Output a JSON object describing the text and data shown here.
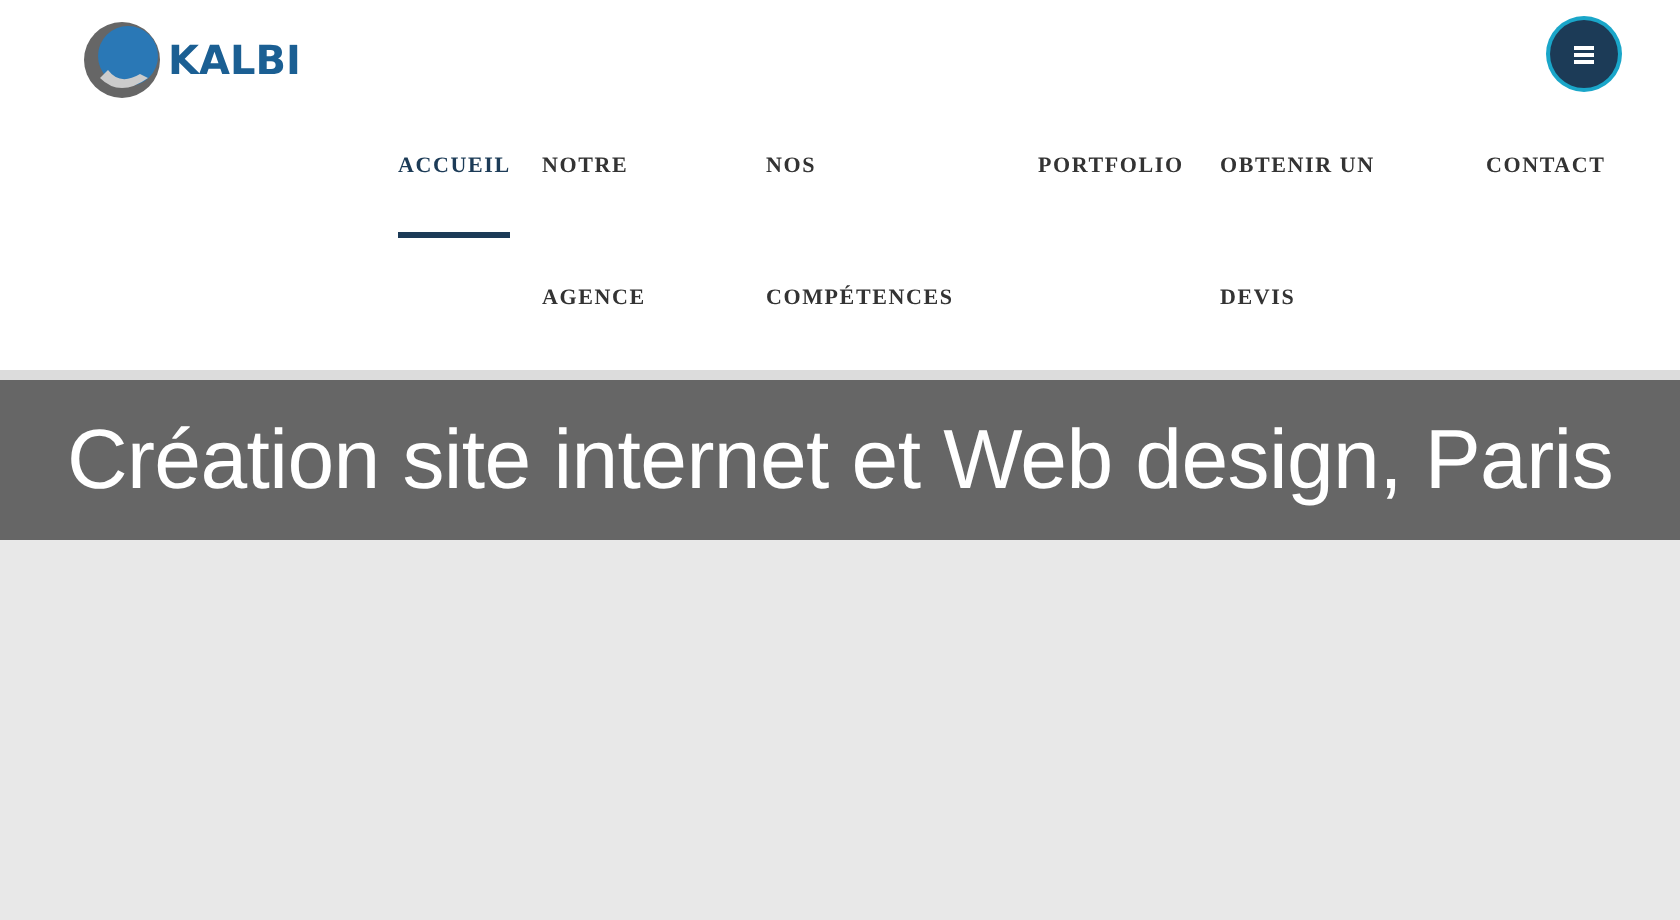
{
  "header": {
    "logo": {
      "text": "KALBI"
    }
  },
  "nav": [
    {
      "label": "ACCUEIL",
      "selected": true
    },
    {
      "label": "NOTRE AGENCE",
      "selected": false
    },
    {
      "label": "NOS COMPÉTENCES",
      "selected": false
    },
    {
      "label": "PORTFOLIO",
      "selected": false
    },
    {
      "label": "OBTENIR UN DEVIS",
      "selected": false
    },
    {
      "label": "CONTACT",
      "selected": false
    }
  ],
  "banner": {
    "title": "Création site internet et Web design, Paris"
  }
}
